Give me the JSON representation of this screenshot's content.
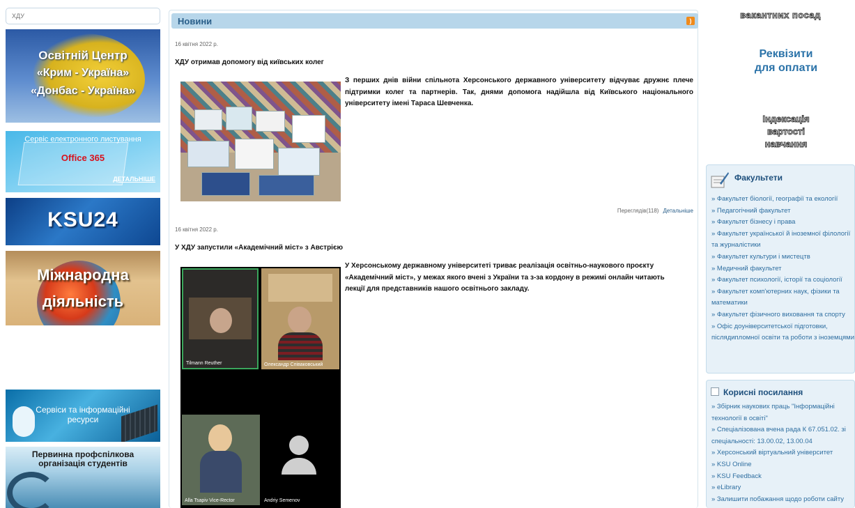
{
  "search": {
    "placeholder": "ХДУ"
  },
  "left_banners": {
    "crimea": {
      "line1": "Освітній Центр",
      "line2": "«Крим - Україна»",
      "line3": "«Донбас - Україна»"
    },
    "office": {
      "title": "Сервіс електронного листування",
      "brand": "Office 365",
      "more": "ДЕТАЛЬНІШЕ"
    },
    "ksu24": {
      "title": "KSU24"
    },
    "international": {
      "line1": "Міжнародна",
      "line2": "діяльність"
    },
    "services": {
      "line1": "Сервіси та інформаційні",
      "line2": "ресурси"
    },
    "union": {
      "line1": "Первинна профспілкова",
      "line2": "організація студентів"
    }
  },
  "news": {
    "header": "Новини",
    "items": [
      {
        "date": "16 квітня 2022 р.",
        "title": "ХДУ отримав допомогу від київських колег",
        "text": "З перших днів війни спільнота Херсонського державного університету відчуває дружнє плече підтримки колег та партнерів. Так, днями допомога надійшла від Київського національного університету імені Тараса Шевченка.",
        "views": "Переглядів(118)",
        "more": "Детальніше"
      },
      {
        "date": "16 квітня 2022 р.",
        "title": "У ХДУ запустили «Академічний міст» з Австрією",
        "text": "У Херсонському державному університеті триває реалізація освітньо-наукового проєкту «Академічний міст», у межах якого вчені з України та з-за кордону в режимі онлайн читають лекції для представників нашого освітнього закладу.",
        "video_labels": [
          "Tilmann Reuther",
          "Олександр Співаковський",
          "Alla Tsapiv Vice-Rector",
          "Andriy Semenov"
        ]
      }
    ]
  },
  "right": {
    "vacancy": "вакантних посад",
    "requisites": {
      "line1": "Реквізити",
      "line2": "для оплати"
    },
    "indexation": {
      "line1": "Індексація",
      "line2": "вартості",
      "line3": "навчання"
    },
    "faculties": {
      "title": "Факультети",
      "items": [
        "» Факультет біології, географії та екології",
        "» Педагогічний факультет",
        "» Факультет бізнесу і права",
        "» Факультет української й іноземної філології та журналістики",
        "» Факультет культури і мистецтв",
        "» Медичний факультет",
        "» Факультет психології, історії та соціології",
        "» Факультет комп'ютерних наук, фізики та математики",
        "» Факультет фізичного виховання та спорту",
        "» Офіс доуніверситетської підготовки, післядипломної освіти та роботи з іноземцями"
      ]
    },
    "links": {
      "title": "Корисні посилання",
      "items": [
        "» Збірник наукових праць \"Інформаційні технології в освіті\"",
        "» Спеціалізована вчена рада К 67.051.02. зі спеціальності: 13.00.02, 13.00.04",
        "» Херсонський віртуальний університет",
        "» KSU Online",
        "» KSU Feedback",
        "» eLibrary",
        "» Залишити побажання щодо роботи сайту"
      ]
    }
  },
  "colors": {
    "header_bg": "#b7d6ea",
    "link": "#2e6ea0",
    "panel_bg": "#e7f1f8",
    "rss": "#f08a1a"
  }
}
